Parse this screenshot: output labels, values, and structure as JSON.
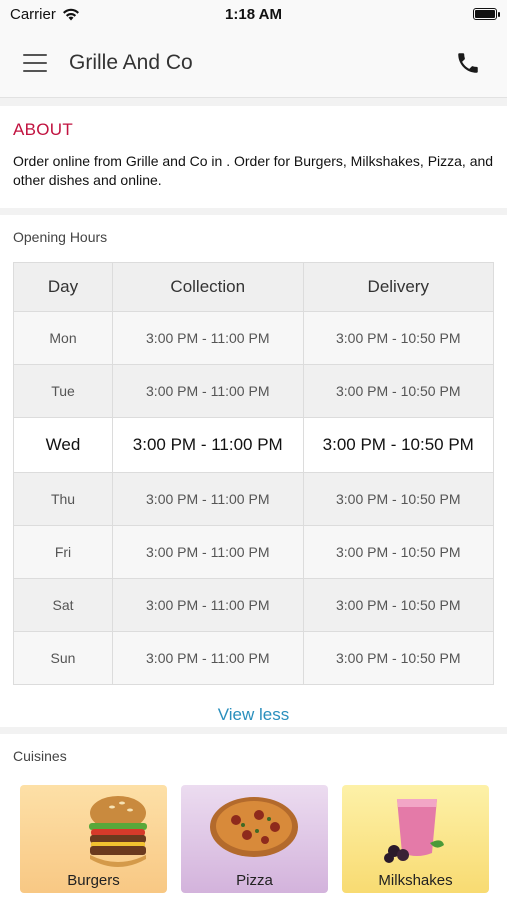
{
  "status_bar": {
    "carrier": "Carrier",
    "time": "1:18 AM"
  },
  "header": {
    "title": "Grille And Co"
  },
  "about": {
    "title": "ABOUT",
    "text": "Order online from Grille and Co in . Order for Burgers, Milkshakes, Pizza, and other dishes and  online."
  },
  "hours": {
    "label": "Opening Hours",
    "columns": [
      "Day",
      "Collection",
      "Delivery"
    ],
    "rows": [
      {
        "day": "Mon",
        "collection": "3:00 PM - 11:00 PM",
        "delivery": "3:00 PM - 10:50 PM"
      },
      {
        "day": "Tue",
        "collection": "3:00 PM - 11:00 PM",
        "delivery": "3:00 PM - 10:50 PM"
      },
      {
        "day": "Wed",
        "collection": "3:00 PM - 11:00 PM",
        "delivery": "3:00 PM - 10:50 PM"
      },
      {
        "day": "Thu",
        "collection": "3:00 PM - 11:00 PM",
        "delivery": "3:00 PM - 10:50 PM"
      },
      {
        "day": "Fri",
        "collection": "3:00 PM - 11:00 PM",
        "delivery": "3:00 PM - 10:50 PM"
      },
      {
        "day": "Sat",
        "collection": "3:00 PM - 11:00 PM",
        "delivery": "3:00 PM - 10:50 PM"
      },
      {
        "day": "Sun",
        "collection": "3:00 PM - 11:00 PM",
        "delivery": "3:00 PM - 10:50 PM"
      }
    ],
    "today": "Wed",
    "toggle_label": "View less"
  },
  "cuisines": {
    "label": "Cuisines",
    "items": [
      {
        "name": "Burgers",
        "icon": "burger-icon"
      },
      {
        "name": "Pizza",
        "icon": "pizza-icon"
      },
      {
        "name": "Milkshakes",
        "icon": "milkshake-icon"
      }
    ]
  },
  "colors": {
    "accent": "#c1123f",
    "link": "#2a8fbd"
  }
}
